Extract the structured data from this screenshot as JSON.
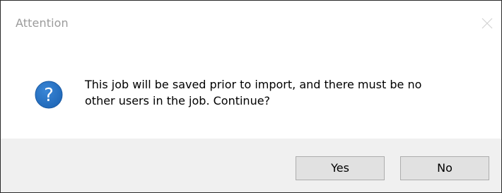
{
  "window": {
    "title": "Attention"
  },
  "icons": {
    "close": "close-icon",
    "question": "question-icon"
  },
  "colors": {
    "question_icon_fill": "#1f67b7",
    "title_text": "#9b9b9b",
    "footer_background": "#f0f0f0",
    "button_background": "#e1e1e1"
  },
  "message": {
    "text": "This job will be saved prior to import, and there must be no\nother users in the job.  Continue?"
  },
  "buttons": {
    "yes_label": "Yes",
    "no_label": "No"
  }
}
